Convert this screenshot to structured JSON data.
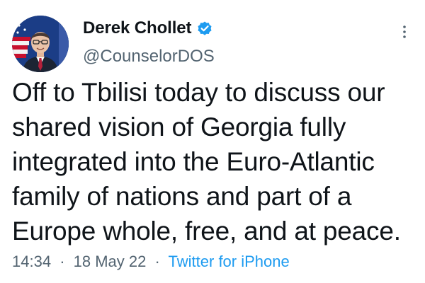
{
  "author": {
    "display_name": "Derek Chollet",
    "handle": "@CounselorDOS",
    "verified": true,
    "avatar_icon": "profile-photo-with-flag"
  },
  "tweet": {
    "lines": [
      "Off to Tbilisi today to discuss our",
      "shared vision of Georgia fully",
      "integrated into the Euro-Atlantic",
      "family of nations and part of a",
      "Europe whole, free, and at peace."
    ]
  },
  "meta": {
    "time": "14:34",
    "date": "18 May 22",
    "separator": "·",
    "source": "Twitter for iPhone"
  },
  "colors": {
    "text": "#0f1419",
    "secondary": "#536471",
    "accent": "#1d9bf0"
  },
  "icons": {
    "verified": "verified-badge-icon",
    "more": "more-options-icon"
  }
}
